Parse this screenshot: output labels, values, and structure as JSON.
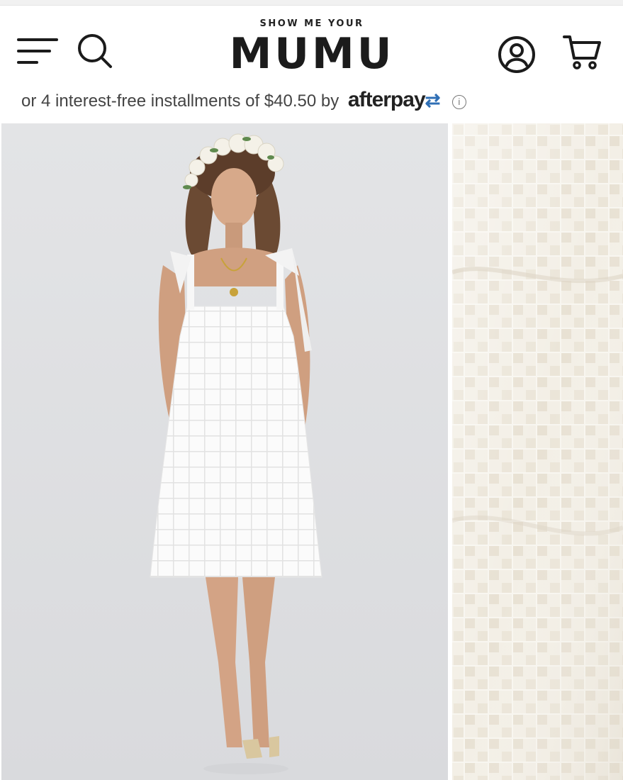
{
  "header": {
    "brand_top": "SHOW ME YOUR",
    "brand_main": "MUMU",
    "icons": {
      "menu": "menu-icon",
      "search": "search-icon",
      "account": "account-icon",
      "cart": "cart-icon"
    }
  },
  "pricing": {
    "installments_text": "or 4 interest-free installments of $40.50 by",
    "provider_text": "afterpay",
    "info_glyph": "i"
  },
  "gallery": {
    "main_photo": "model-white-gingham-dress-photo",
    "detail_photo": "fabric-closeup-photo"
  },
  "colors": {
    "accent": "#1b1b1b",
    "photo_background": "#e1e2e4",
    "dress": "#ffffff",
    "fabric": "#efeae0"
  }
}
